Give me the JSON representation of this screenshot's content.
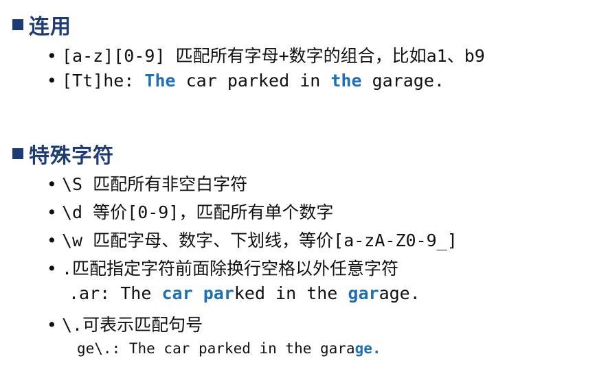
{
  "section1": {
    "title": "连用",
    "items": [
      {
        "text": "[a-z][0-9] 匹配所有字母+数字的组合，比如a1、b9"
      },
      {
        "prefix": "[Tt]he: ",
        "m1": "The",
        "t1": " car parked in ",
        "m2": "the",
        "t2": " garage."
      }
    ]
  },
  "section2": {
    "title": "特殊字符",
    "items": [
      {
        "text": "\\S 匹配所有非空白字符"
      },
      {
        "text": "\\d 等价[0-9]，匹配所有单个数字"
      },
      {
        "text": "\\w 匹配字母、数字、下划线，等价[a-zA-Z0-9_]"
      },
      {
        "text": ".匹配指定字符前面除换行空格以外任意字符"
      },
      {
        "text": "\\.可表示匹配句号"
      }
    ],
    "example_dot": {
      "prefix": ".ar: The ",
      "m1": "car",
      "t1": " ",
      "m2": "par",
      "t2": "ked in the ",
      "m3": "gar",
      "t3": "age."
    },
    "example_escape": {
      "prefix": "ge\\.: The car parked in the gara",
      "m1": "ge."
    }
  },
  "colors": {
    "title": "#1f3b73",
    "highlight": "#1f6fb5"
  }
}
